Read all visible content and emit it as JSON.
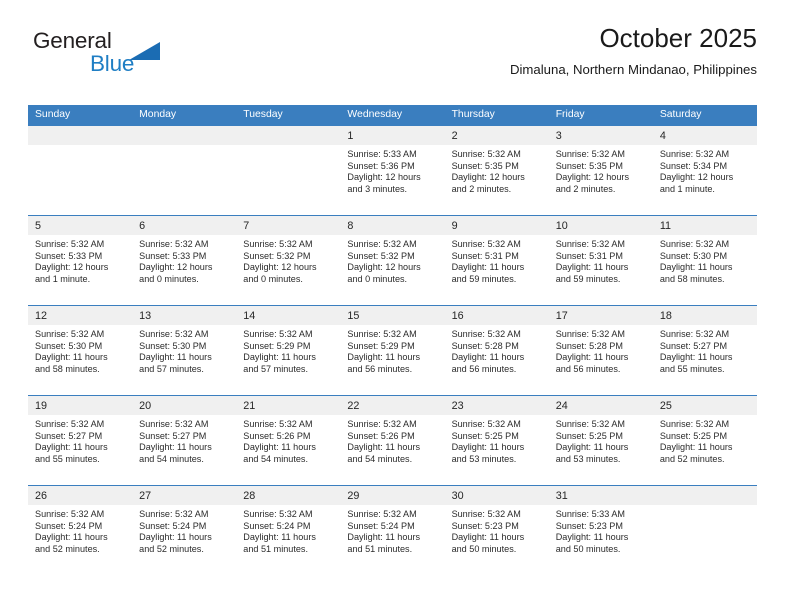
{
  "brand": {
    "name_part1": "General",
    "name_part2": "Blue",
    "triangle_color": "#1b6cb3",
    "blue_color": "#1f7ec4"
  },
  "header": {
    "title": "October 2025",
    "subtitle": "Dimaluna, Northern Mindanao, Philippines",
    "header_bg": "#3a7ebf",
    "daynum_bg": "#f0f0f0"
  },
  "weekdays": [
    "Sunday",
    "Monday",
    "Tuesday",
    "Wednesday",
    "Thursday",
    "Friday",
    "Saturday"
  ],
  "weeks": [
    [
      {
        "day": "",
        "sunrise": "",
        "sunset": "",
        "daylight_line1": "",
        "daylight_line2": ""
      },
      {
        "day": "",
        "sunrise": "",
        "sunset": "",
        "daylight_line1": "",
        "daylight_line2": ""
      },
      {
        "day": "",
        "sunrise": "",
        "sunset": "",
        "daylight_line1": "",
        "daylight_line2": ""
      },
      {
        "day": "1",
        "sunrise": "Sunrise: 5:33 AM",
        "sunset": "Sunset: 5:36 PM",
        "daylight_line1": "Daylight: 12 hours",
        "daylight_line2": "and 3 minutes."
      },
      {
        "day": "2",
        "sunrise": "Sunrise: 5:32 AM",
        "sunset": "Sunset: 5:35 PM",
        "daylight_line1": "Daylight: 12 hours",
        "daylight_line2": "and 2 minutes."
      },
      {
        "day": "3",
        "sunrise": "Sunrise: 5:32 AM",
        "sunset": "Sunset: 5:35 PM",
        "daylight_line1": "Daylight: 12 hours",
        "daylight_line2": "and 2 minutes."
      },
      {
        "day": "4",
        "sunrise": "Sunrise: 5:32 AM",
        "sunset": "Sunset: 5:34 PM",
        "daylight_line1": "Daylight: 12 hours",
        "daylight_line2": "and 1 minute."
      }
    ],
    [
      {
        "day": "5",
        "sunrise": "Sunrise: 5:32 AM",
        "sunset": "Sunset: 5:33 PM",
        "daylight_line1": "Daylight: 12 hours",
        "daylight_line2": "and 1 minute."
      },
      {
        "day": "6",
        "sunrise": "Sunrise: 5:32 AM",
        "sunset": "Sunset: 5:33 PM",
        "daylight_line1": "Daylight: 12 hours",
        "daylight_line2": "and 0 minutes."
      },
      {
        "day": "7",
        "sunrise": "Sunrise: 5:32 AM",
        "sunset": "Sunset: 5:32 PM",
        "daylight_line1": "Daylight: 12 hours",
        "daylight_line2": "and 0 minutes."
      },
      {
        "day": "8",
        "sunrise": "Sunrise: 5:32 AM",
        "sunset": "Sunset: 5:32 PM",
        "daylight_line1": "Daylight: 12 hours",
        "daylight_line2": "and 0 minutes."
      },
      {
        "day": "9",
        "sunrise": "Sunrise: 5:32 AM",
        "sunset": "Sunset: 5:31 PM",
        "daylight_line1": "Daylight: 11 hours",
        "daylight_line2": "and 59 minutes."
      },
      {
        "day": "10",
        "sunrise": "Sunrise: 5:32 AM",
        "sunset": "Sunset: 5:31 PM",
        "daylight_line1": "Daylight: 11 hours",
        "daylight_line2": "and 59 minutes."
      },
      {
        "day": "11",
        "sunrise": "Sunrise: 5:32 AM",
        "sunset": "Sunset: 5:30 PM",
        "daylight_line1": "Daylight: 11 hours",
        "daylight_line2": "and 58 minutes."
      }
    ],
    [
      {
        "day": "12",
        "sunrise": "Sunrise: 5:32 AM",
        "sunset": "Sunset: 5:30 PM",
        "daylight_line1": "Daylight: 11 hours",
        "daylight_line2": "and 58 minutes."
      },
      {
        "day": "13",
        "sunrise": "Sunrise: 5:32 AM",
        "sunset": "Sunset: 5:30 PM",
        "daylight_line1": "Daylight: 11 hours",
        "daylight_line2": "and 57 minutes."
      },
      {
        "day": "14",
        "sunrise": "Sunrise: 5:32 AM",
        "sunset": "Sunset: 5:29 PM",
        "daylight_line1": "Daylight: 11 hours",
        "daylight_line2": "and 57 minutes."
      },
      {
        "day": "15",
        "sunrise": "Sunrise: 5:32 AM",
        "sunset": "Sunset: 5:29 PM",
        "daylight_line1": "Daylight: 11 hours",
        "daylight_line2": "and 56 minutes."
      },
      {
        "day": "16",
        "sunrise": "Sunrise: 5:32 AM",
        "sunset": "Sunset: 5:28 PM",
        "daylight_line1": "Daylight: 11 hours",
        "daylight_line2": "and 56 minutes."
      },
      {
        "day": "17",
        "sunrise": "Sunrise: 5:32 AM",
        "sunset": "Sunset: 5:28 PM",
        "daylight_line1": "Daylight: 11 hours",
        "daylight_line2": "and 56 minutes."
      },
      {
        "day": "18",
        "sunrise": "Sunrise: 5:32 AM",
        "sunset": "Sunset: 5:27 PM",
        "daylight_line1": "Daylight: 11 hours",
        "daylight_line2": "and 55 minutes."
      }
    ],
    [
      {
        "day": "19",
        "sunrise": "Sunrise: 5:32 AM",
        "sunset": "Sunset: 5:27 PM",
        "daylight_line1": "Daylight: 11 hours",
        "daylight_line2": "and 55 minutes."
      },
      {
        "day": "20",
        "sunrise": "Sunrise: 5:32 AM",
        "sunset": "Sunset: 5:27 PM",
        "daylight_line1": "Daylight: 11 hours",
        "daylight_line2": "and 54 minutes."
      },
      {
        "day": "21",
        "sunrise": "Sunrise: 5:32 AM",
        "sunset": "Sunset: 5:26 PM",
        "daylight_line1": "Daylight: 11 hours",
        "daylight_line2": "and 54 minutes."
      },
      {
        "day": "22",
        "sunrise": "Sunrise: 5:32 AM",
        "sunset": "Sunset: 5:26 PM",
        "daylight_line1": "Daylight: 11 hours",
        "daylight_line2": "and 54 minutes."
      },
      {
        "day": "23",
        "sunrise": "Sunrise: 5:32 AM",
        "sunset": "Sunset: 5:25 PM",
        "daylight_line1": "Daylight: 11 hours",
        "daylight_line2": "and 53 minutes."
      },
      {
        "day": "24",
        "sunrise": "Sunrise: 5:32 AM",
        "sunset": "Sunset: 5:25 PM",
        "daylight_line1": "Daylight: 11 hours",
        "daylight_line2": "and 53 minutes."
      },
      {
        "day": "25",
        "sunrise": "Sunrise: 5:32 AM",
        "sunset": "Sunset: 5:25 PM",
        "daylight_line1": "Daylight: 11 hours",
        "daylight_line2": "and 52 minutes."
      }
    ],
    [
      {
        "day": "26",
        "sunrise": "Sunrise: 5:32 AM",
        "sunset": "Sunset: 5:24 PM",
        "daylight_line1": "Daylight: 11 hours",
        "daylight_line2": "and 52 minutes."
      },
      {
        "day": "27",
        "sunrise": "Sunrise: 5:32 AM",
        "sunset": "Sunset: 5:24 PM",
        "daylight_line1": "Daylight: 11 hours",
        "daylight_line2": "and 52 minutes."
      },
      {
        "day": "28",
        "sunrise": "Sunrise: 5:32 AM",
        "sunset": "Sunset: 5:24 PM",
        "daylight_line1": "Daylight: 11 hours",
        "daylight_line2": "and 51 minutes."
      },
      {
        "day": "29",
        "sunrise": "Sunrise: 5:32 AM",
        "sunset": "Sunset: 5:24 PM",
        "daylight_line1": "Daylight: 11 hours",
        "daylight_line2": "and 51 minutes."
      },
      {
        "day": "30",
        "sunrise": "Sunrise: 5:32 AM",
        "sunset": "Sunset: 5:23 PM",
        "daylight_line1": "Daylight: 11 hours",
        "daylight_line2": "and 50 minutes."
      },
      {
        "day": "31",
        "sunrise": "Sunrise: 5:33 AM",
        "sunset": "Sunset: 5:23 PM",
        "daylight_line1": "Daylight: 11 hours",
        "daylight_line2": "and 50 minutes."
      },
      {
        "day": "",
        "sunrise": "",
        "sunset": "",
        "daylight_line1": "",
        "daylight_line2": ""
      }
    ]
  ]
}
